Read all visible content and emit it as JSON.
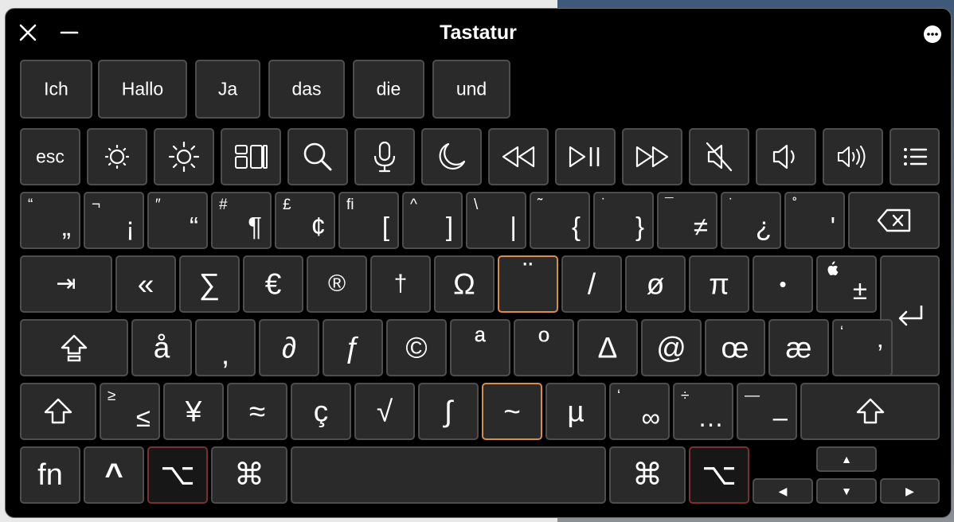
{
  "window": {
    "title": "Tastatur"
  },
  "suggestions": [
    "Ich",
    "Hallo",
    "Ja",
    "das",
    "die",
    "und"
  ],
  "fn_row": {
    "esc": "esc",
    "icons": [
      "brightness-down-icon",
      "brightness-up-icon",
      "mission-control-icon",
      "spotlight-search-icon",
      "dictation-mic-icon",
      "do-not-disturb-moon-icon",
      "rewind-icon",
      "play-pause-icon",
      "fast-forward-icon",
      "mute-icon",
      "volume-down-icon",
      "volume-up-icon",
      "list-icon"
    ]
  },
  "number_row": [
    {
      "main": "„",
      "sec": "“"
    },
    {
      "main": "¡",
      "sec": "¬"
    },
    {
      "main": "“",
      "sec": "″"
    },
    {
      "main": "¶",
      "sec": "#"
    },
    {
      "main": "¢",
      "sec": "£"
    },
    {
      "main": "[",
      "sec": "ﬁ"
    },
    {
      "main": "]",
      "sec": "^"
    },
    {
      "main": "|",
      "sec": "\\"
    },
    {
      "main": "{",
      "sec": "˜"
    },
    {
      "main": "}",
      "sec": "˙"
    },
    {
      "main": "≠",
      "sec": "¯"
    },
    {
      "main": "¿",
      "sec": "˙"
    },
    {
      "main": "'",
      "sec": "˚"
    }
  ],
  "qwerty_row": {
    "tab": "⇥",
    "keys": [
      "«",
      "∑",
      "€",
      "®",
      "†",
      "Ω",
      "¨",
      "/",
      "ø",
      "π",
      "•"
    ],
    "last": {
      "main": "±",
      "sec": ""
    }
  },
  "home_row": {
    "keys": [
      "å",
      ",",
      "∂",
      "ƒ",
      "©",
      "ª",
      "º",
      "∆",
      "@",
      "œ",
      "æ"
    ],
    "last": {
      "main": "’",
      "sec": "‘"
    }
  },
  "bottom_row": {
    "keys": [
      {
        "main": "≤",
        "sec": "≥"
      },
      {
        "main": "¥",
        "sec": ""
      },
      {
        "main": "≈",
        "sec": ""
      },
      {
        "main": "ç",
        "sec": ""
      },
      {
        "main": "√",
        "sec": ""
      },
      {
        "main": "∫",
        "sec": ""
      },
      {
        "main": "~",
        "sec": ""
      },
      {
        "main": "µ",
        "sec": ""
      },
      {
        "main": "∞",
        "sec": "‘"
      },
      {
        "main": "…",
        "sec": "÷"
      },
      {
        "main": "–",
        "sec": "—"
      }
    ]
  },
  "modifier_row": {
    "fn": "fn",
    "ctrl": "^",
    "option": "⌥",
    "command": "⌘"
  },
  "arrows": {
    "up": "▲",
    "left": "◀",
    "down": "▼",
    "right": "▶"
  },
  "colors": {
    "key_bg": "#2a2a2a",
    "key_border": "#4e4e4e",
    "active_orange": "#d78d4c",
    "active_red": "#7a3030",
    "window_bg": "#000000"
  }
}
